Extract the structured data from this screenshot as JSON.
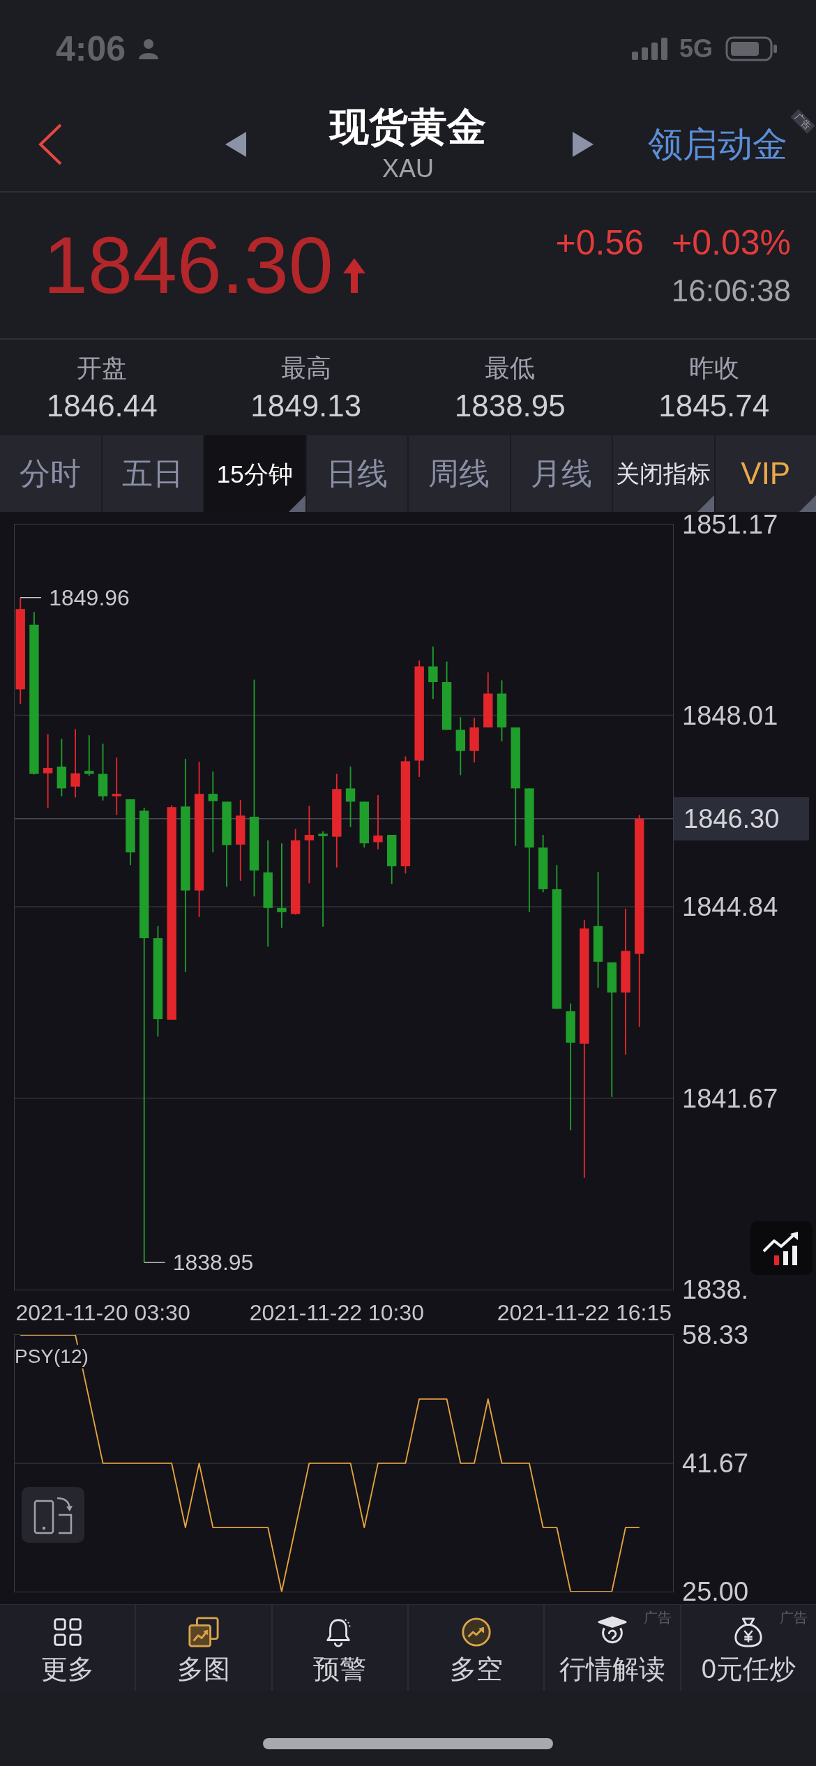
{
  "status_bar": {
    "time": "4:06",
    "network": "5G"
  },
  "header": {
    "title": "现货黄金",
    "symbol": "XAU",
    "promo": {
      "label": "领启动金",
      "ad_tag": "广告"
    }
  },
  "quote": {
    "price": "1846.30",
    "rising": true,
    "change": "+0.56",
    "change_percent": "+0.03%",
    "time": "16:06:38"
  },
  "stats": [
    {
      "label": "开盘",
      "value": "1846.44"
    },
    {
      "label": "最高",
      "value": "1849.13"
    },
    {
      "label": "最低",
      "value": "1838.95"
    },
    {
      "label": "昨收",
      "value": "1845.74"
    }
  ],
  "tabs": [
    {
      "label": "分时",
      "kind": "period",
      "selected": false,
      "dropdown": false
    },
    {
      "label": "五日",
      "kind": "period",
      "selected": false,
      "dropdown": false
    },
    {
      "label": "15分钟",
      "kind": "interval",
      "selected": true,
      "dropdown": true
    },
    {
      "label": "日线",
      "kind": "period",
      "selected": false,
      "dropdown": false
    },
    {
      "label": "周线",
      "kind": "period",
      "selected": false,
      "dropdown": false
    },
    {
      "label": "月线",
      "kind": "period",
      "selected": false,
      "dropdown": false
    },
    {
      "label": "关闭指标",
      "kind": "toggle",
      "selected": false,
      "dropdown": true
    },
    {
      "label": "VIP",
      "kind": "vip",
      "selected": false,
      "dropdown": true
    }
  ],
  "chart": {
    "chart_data": {
      "type": "candlestick",
      "categories": [
        null,
        null,
        null,
        null,
        null,
        null,
        "2021-11-20 03:30",
        null,
        null,
        null,
        null,
        null,
        null,
        null,
        null,
        null,
        null,
        null,
        null,
        null,
        null,
        null,
        null,
        "2021-11-22 10:30",
        null,
        null,
        null,
        null,
        null,
        null,
        null,
        null,
        null,
        null,
        null,
        null,
        null,
        null,
        null,
        null,
        null,
        "2021-11-22 16:15",
        null,
        null,
        null,
        null
      ],
      "ohlc": [
        [
          1848.44,
          1849.96,
          1848.2,
          1849.77
        ],
        [
          1849.51,
          1849.72,
          1847.03,
          1847.04
        ],
        [
          1847.05,
          1847.7,
          1846.48,
          1847.14
        ],
        [
          1847.16,
          1847.62,
          1846.67,
          1846.8
        ],
        [
          1846.83,
          1847.78,
          1846.65,
          1847.05
        ],
        [
          1847.09,
          1847.68,
          1847.01,
          1847.04
        ],
        [
          1847.04,
          1847.54,
          1846.6,
          1846.67
        ],
        [
          1846.67,
          1847.31,
          1846.36,
          1846.71
        ],
        [
          1846.62,
          1846.62,
          1845.53,
          1845.74
        ],
        [
          1846.43,
          1846.48,
          1838.95,
          1844.32
        ],
        [
          1844.32,
          1844.52,
          1842.69,
          1842.98
        ],
        [
          1842.97,
          1846.52,
          1842.97,
          1846.49
        ],
        [
          1846.5,
          1847.29,
          1843.76,
          1845.11
        ],
        [
          1845.11,
          1847.24,
          1844.67,
          1846.71
        ],
        [
          1846.71,
          1847.08,
          1845.74,
          1846.59
        ],
        [
          1846.58,
          1846.58,
          1845.17,
          1845.86
        ],
        [
          1845.87,
          1846.61,
          1845.27,
          1846.35
        ],
        [
          1846.33,
          1848.6,
          1845.01,
          1845.44
        ],
        [
          1845.41,
          1845.94,
          1844.18,
          1844.82
        ],
        [
          1844.82,
          1845.89,
          1844.49,
          1844.75
        ],
        [
          1844.72,
          1846.13,
          1844.71,
          1845.94
        ],
        [
          1845.94,
          1846.51,
          1845.23,
          1846.03
        ],
        [
          1846.05,
          1846.09,
          1844.51,
          1846.01
        ],
        [
          1846.0,
          1847.04,
          1845.49,
          1846.79
        ],
        [
          1846.8,
          1847.16,
          1846.16,
          1846.58
        ],
        [
          1846.58,
          1846.58,
          1845.82,
          1845.89
        ],
        [
          1845.91,
          1846.69,
          1845.79,
          1846.02
        ],
        [
          1846.03,
          1846.03,
          1845.22,
          1845.51
        ],
        [
          1845.51,
          1847.33,
          1845.39,
          1847.25
        ],
        [
          1847.26,
          1848.92,
          1846.99,
          1848.82
        ],
        [
          1848.82,
          1849.15,
          1848.28,
          1848.56
        ],
        [
          1848.56,
          1848.9,
          1847.77,
          1847.77
        ],
        [
          1847.77,
          1847.98,
          1847.02,
          1847.42
        ],
        [
          1847.42,
          1847.97,
          1847.23,
          1847.81
        ],
        [
          1847.81,
          1848.72,
          1847.81,
          1848.37
        ],
        [
          1848.37,
          1848.59,
          1847.58,
          1847.81
        ],
        [
          1847.81,
          1847.81,
          1845.85,
          1846.8
        ],
        [
          1846.8,
          1846.8,
          1844.75,
          1845.82
        ],
        [
          1845.82,
          1846.03,
          1845.08,
          1845.13
        ],
        [
          1845.13,
          1845.53,
          1843.15,
          1843.15
        ],
        [
          1843.11,
          1843.24,
          1841.14,
          1842.59
        ],
        [
          1842.57,
          1844.62,
          1840.35,
          1844.48
        ],
        [
          1844.52,
          1845.42,
          1843.5,
          1843.93
        ],
        [
          1843.92,
          1843.92,
          1841.69,
          1843.42
        ],
        [
          1843.42,
          1844.81,
          1842.39,
          1844.11
        ],
        [
          1844.06,
          1846.36,
          1842.85,
          1846.3
        ]
      ],
      "ylim": [
        1838.5,
        1851.17
      ],
      "yticks": [
        1851.17,
        1848.01,
        1844.84,
        1841.67,
        {
          "value": 1838.5,
          "label": "1838."
        }
      ],
      "grid": true,
      "ref_lines": [
        {
          "axis": "y",
          "value": 1846.3,
          "label": "1846.30"
        }
      ],
      "annotations": [
        "1849.96",
        "1838.95"
      ]
    }
  },
  "indicator": {
    "chart_data": {
      "type": "line",
      "ylim": [
        25,
        58.33
      ],
      "yticks": [
        58.33,
        41.67,
        {
          "value": 25,
          "label": "25.00"
        }
      ],
      "grid": true,
      "series": [
        {
          "name": "PSY(12)",
          "color": "#e6a43c",
          "values": [
            58.33,
            58.33,
            58.33,
            58.33,
            58.33,
            50,
            41.67,
            41.67,
            41.67,
            41.67,
            41.67,
            41.67,
            33.33,
            41.67,
            33.33,
            33.33,
            33.33,
            33.33,
            33.33,
            25,
            33.33,
            41.67,
            41.67,
            41.67,
            41.67,
            33.33,
            41.67,
            41.67,
            41.67,
            50,
            50,
            50,
            41.67,
            41.67,
            50,
            41.67,
            41.67,
            41.67,
            33.33,
            33.33,
            25,
            25,
            25,
            25,
            33.33,
            33.33
          ]
        }
      ]
    }
  },
  "bottom_nav": [
    {
      "label": "更多"
    },
    {
      "label": "多图"
    },
    {
      "label": "预警"
    },
    {
      "label": "多空"
    },
    {
      "label": "行情解读",
      "ad_tag": "广告"
    },
    {
      "label": "0元任炒",
      "ad_tag": "广告"
    }
  ]
}
